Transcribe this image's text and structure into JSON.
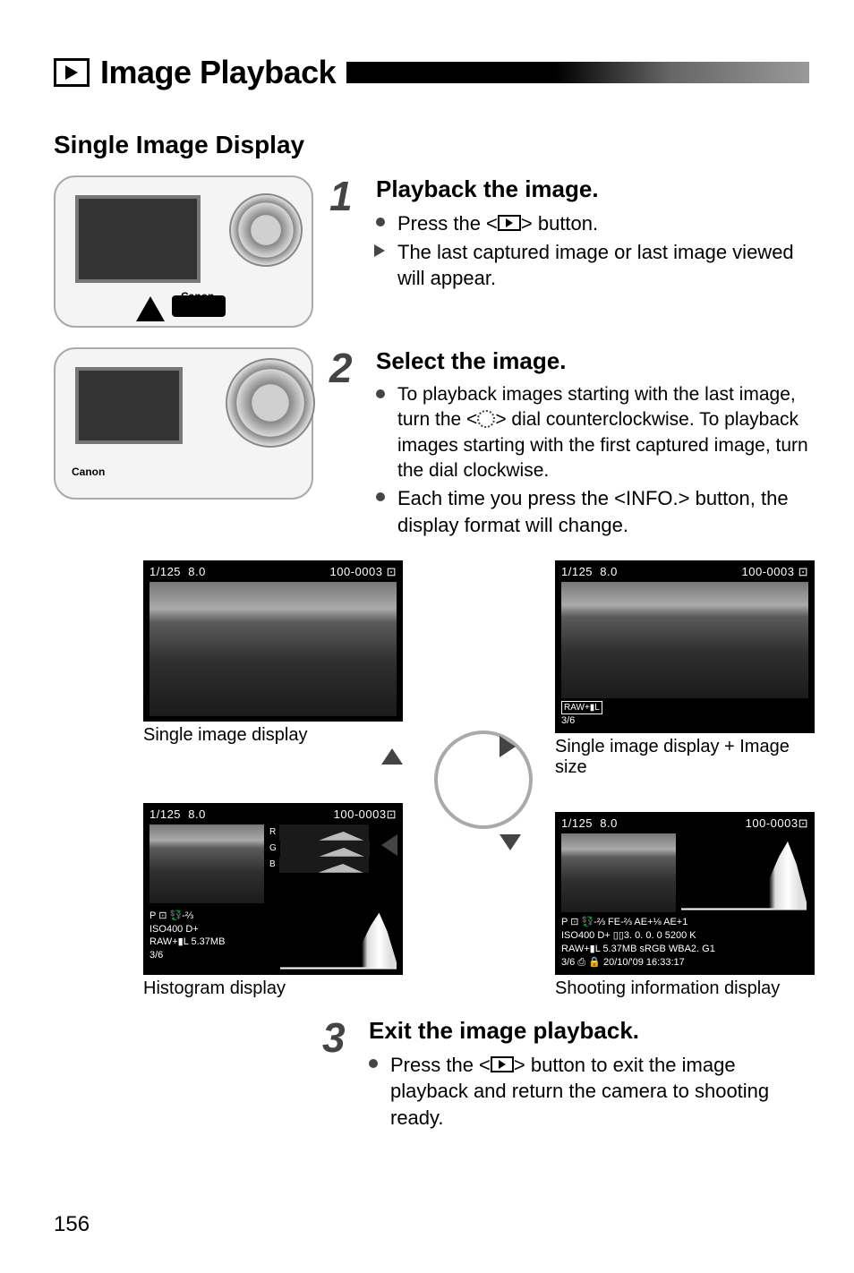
{
  "header": {
    "title": "Image Playback"
  },
  "section_heading": "Single Image Display",
  "steps": [
    {
      "num": "1",
      "title": "Playback the image.",
      "bullets": [
        {
          "type": "dot",
          "pre": "Press the <",
          "post": "> button."
        },
        {
          "type": "arrow",
          "text": "The last captured image or last image viewed will appear."
        }
      ],
      "illustration_brand": "Canon"
    },
    {
      "num": "2",
      "title": "Select the image.",
      "bullets": [
        {
          "type": "dot",
          "text_a": "To playback images starting with the last image, turn the <",
          "text_b": "> dial counterclockwise. To playback images starting with the first captured image, turn the dial clockwise."
        },
        {
          "type": "dot",
          "text": "Each time you press the <INFO.> button, the display format will change."
        }
      ],
      "illustration_brand": "Canon"
    },
    {
      "num": "3",
      "title": "Exit the image playback.",
      "bullets": [
        {
          "type": "dot",
          "pre": "Press the <",
          "post": "> button to exit the image playback and return the camera to shooting ready."
        }
      ]
    }
  ],
  "displays": {
    "top_left": {
      "shutter": "1/125",
      "aperture": "8.0",
      "file": "100-0003",
      "caption": "Single image display"
    },
    "top_right": {
      "shutter": "1/125",
      "aperture": "8.0",
      "file": "100-0003",
      "quality": "RAW+▮L",
      "counter": "3/6",
      "caption": "Single image display + Image size"
    },
    "bottom_left": {
      "shutter": "1/125",
      "aperture": "8.0",
      "file": "100-0003",
      "rgb_labels": [
        "R",
        "G",
        "B"
      ],
      "line1": "P ⊡ 💱-⅔",
      "line2": "ISO400  D+",
      "line3": "RAW+▮L  5.37MB",
      "counter": "3/6",
      "caption": "Histogram display"
    },
    "bottom_right": {
      "shutter": "1/125",
      "aperture": "8.0",
      "file": "100-0003",
      "line1": "P ⊡ 💱-⅔  FE-⅔ AE+⅛ AE+1",
      "line2": "ISO400  D+ ▯▯3. 0. 0. 0    5200 K",
      "line3": "RAW+▮L  5.37MB sRGB    WBA2. G1",
      "line4": "3/6     ⎙ 🔒 20/10/'09 16:33:17",
      "caption": "Shooting information display"
    }
  },
  "page_number": "156"
}
